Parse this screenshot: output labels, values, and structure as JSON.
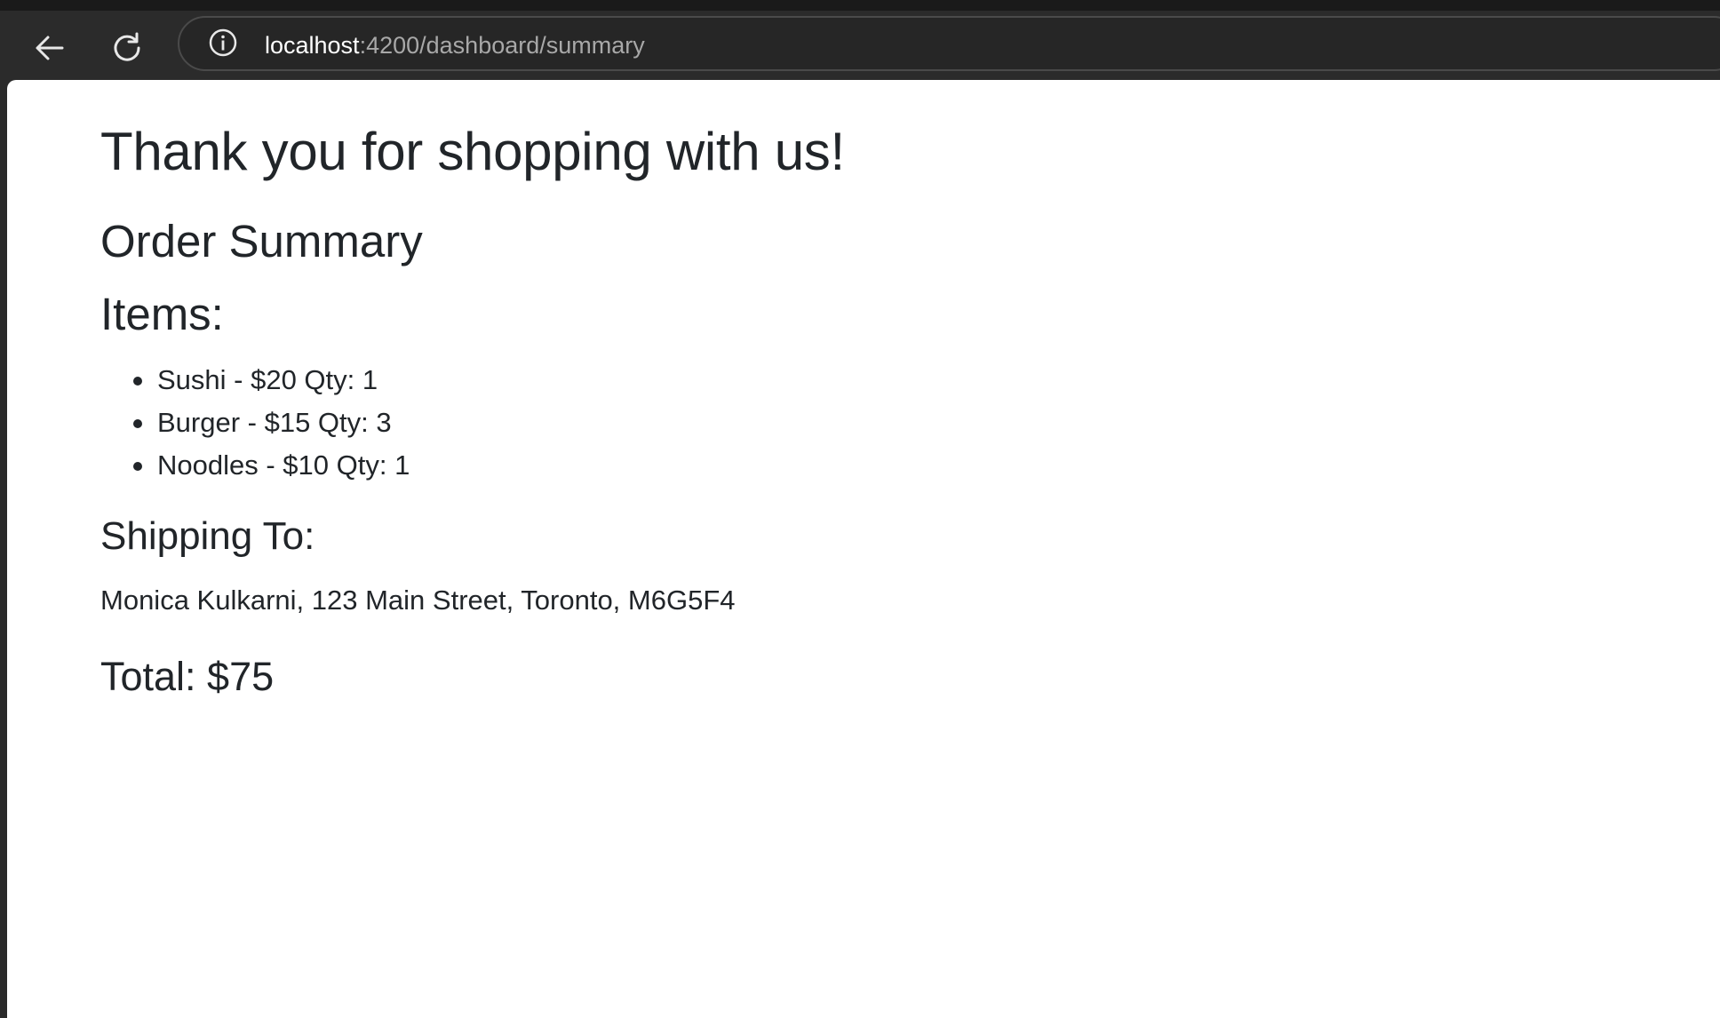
{
  "browser": {
    "url_host": "localhost",
    "url_rest": ":4200/dashboard/summary",
    "icons": {
      "back": "back-arrow-icon",
      "reload": "reload-icon",
      "site_info": "info-icon"
    }
  },
  "page": {
    "thanks_heading": "Thank you for shopping with us!",
    "summary_heading": "Order Summary",
    "items_heading": "Items:",
    "items": [
      {
        "text": "Sushi - $20 Qty: 1"
      },
      {
        "text": "Burger - $15 Qty: 3"
      },
      {
        "text": "Noodles - $10 Qty: 1"
      }
    ],
    "shipping_heading": "Shipping To:",
    "shipping_address": "Monica Kulkarni, 123 Main Street, Toronto, M6G5F4",
    "total": "Total: $75"
  },
  "colors": {
    "text": "#212529",
    "toolbar": "#2b2b2b",
    "url_host": "#ffffff",
    "url_rest": "#a8a8a8"
  }
}
